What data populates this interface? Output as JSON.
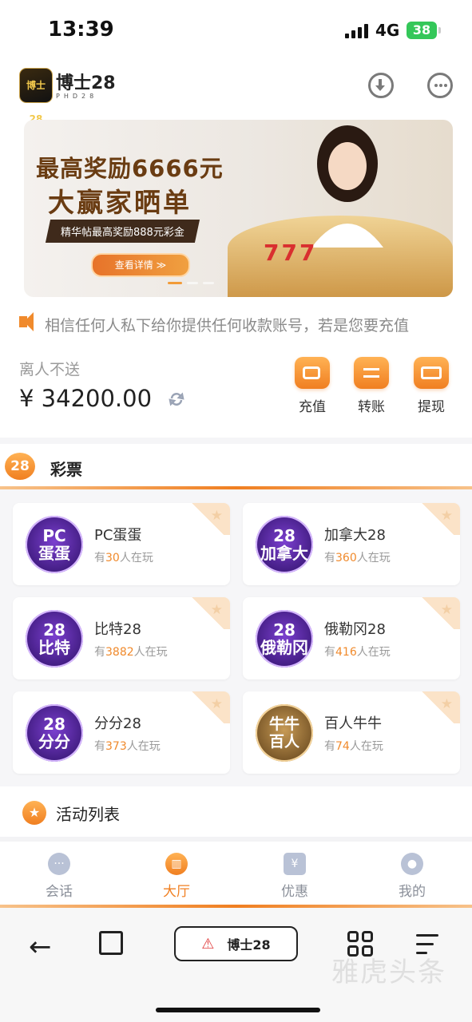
{
  "status_bar": {
    "time": "13:39",
    "network": "4G",
    "battery": "38"
  },
  "header": {
    "brand": "博士28",
    "brand_sub": "PHD28",
    "logo_text": "博士28"
  },
  "banner": {
    "title_line1": "最高奖励6666元",
    "title_line2": "大赢家晒单",
    "subtitle": "精华帖最高奖励888元彩金",
    "button": "查看详情 ≫",
    "slots": "777"
  },
  "marquee": {
    "text": "相信任何人私下给你提供任何收款账号，若是您要充值"
  },
  "wallet": {
    "user_name": "离人不送",
    "balance": "¥ 34200.00",
    "actions": [
      {
        "label": "充值",
        "icon": "wallet-icon"
      },
      {
        "label": "转账",
        "icon": "transfer-icon"
      },
      {
        "label": "提现",
        "icon": "card-icon"
      }
    ]
  },
  "lottery": {
    "badge": "28",
    "title": "彩票",
    "play_prefix": "有",
    "play_suffix": "人在玩",
    "games": [
      {
        "name": "PC蛋蛋",
        "players": "30",
        "icon_text": "PC\n蛋蛋"
      },
      {
        "name": "加拿大28",
        "players": "360",
        "icon_text": "28\n加拿大"
      },
      {
        "name": "比特28",
        "players": "3882",
        "icon_text": "28\n比特"
      },
      {
        "name": "俄勒冈28",
        "players": "416",
        "icon_text": "28\n俄勒冈"
      },
      {
        "name": "分分28",
        "players": "373",
        "icon_text": "28\n分分"
      },
      {
        "name": "百人牛牛",
        "players": "74",
        "icon_text": "牛牛\n百人"
      }
    ]
  },
  "activity": {
    "title": "活动列表"
  },
  "tabbar": {
    "items": [
      {
        "label": "会话",
        "icon": "chat-icon",
        "glyph": "···"
      },
      {
        "label": "大厅",
        "icon": "hall-icon",
        "glyph": "▥"
      },
      {
        "label": "优惠",
        "icon": "coupon-icon",
        "glyph": "¥"
      },
      {
        "label": "我的",
        "icon": "user-icon",
        "glyph": "●"
      }
    ],
    "active_index": 1
  },
  "browser": {
    "url_label": "博士28"
  },
  "watermark": "雅虎头条"
}
